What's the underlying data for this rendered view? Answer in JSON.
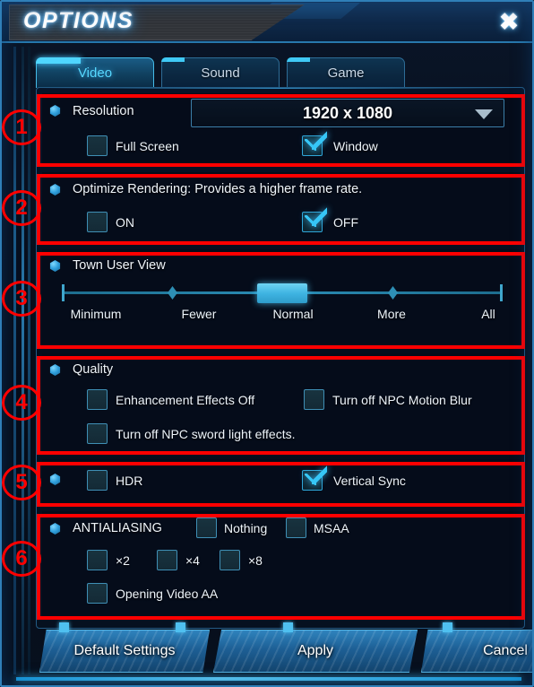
{
  "window": {
    "title": "OPTIONS",
    "close_icon": "close-icon",
    "accent_color": "#3fc9f5",
    "annotation_color": "#ff0000"
  },
  "tabs": [
    {
      "label": "Video",
      "active": true
    },
    {
      "label": "Sound",
      "active": false
    },
    {
      "label": "Game",
      "active": false
    }
  ],
  "sections": [
    {
      "number": "1",
      "label": "Resolution",
      "dropdown": {
        "value": "1920 x 1080",
        "arrow_icon": "chevron-down-icon"
      },
      "checkboxes": [
        {
          "label": "Full Screen",
          "checked": false
        },
        {
          "label": "Window",
          "checked": true
        }
      ]
    },
    {
      "number": "2",
      "label": "Optimize Rendering: Provides a higher frame rate.",
      "checkboxes": [
        {
          "label": "ON",
          "checked": false
        },
        {
          "label": "OFF",
          "checked": true
        }
      ]
    },
    {
      "number": "3",
      "label": "Town User View",
      "slider": {
        "ticks": [
          "Minimum",
          "Fewer",
          "Normal",
          "More",
          "All"
        ],
        "value": "Normal",
        "value_index": 2
      }
    },
    {
      "number": "4",
      "label": "Quality",
      "checkboxes": [
        {
          "label": "Enhancement Effects Off",
          "checked": false
        },
        {
          "label": "Turn off NPC Motion Blur",
          "checked": false
        },
        {
          "label": "Turn off NPC sword light effects.",
          "checked": false
        }
      ]
    },
    {
      "number": "5",
      "label": "",
      "checkboxes": [
        {
          "label": "HDR",
          "checked": false
        },
        {
          "label": "Vertical Sync",
          "checked": true
        }
      ]
    },
    {
      "number": "6",
      "label": "ANTIALIASING",
      "checkboxes": [
        {
          "label": "Nothing",
          "checked": false
        },
        {
          "label": "MSAA",
          "checked": false
        },
        {
          "label": "×2",
          "checked": false
        },
        {
          "label": "×4",
          "checked": false
        },
        {
          "label": "×8",
          "checked": false
        },
        {
          "label": "Opening Video AA",
          "checked": false
        }
      ]
    }
  ],
  "buttons": [
    {
      "label": "Default Settings"
    },
    {
      "label": "Apply"
    },
    {
      "label": "Cancel"
    }
  ]
}
